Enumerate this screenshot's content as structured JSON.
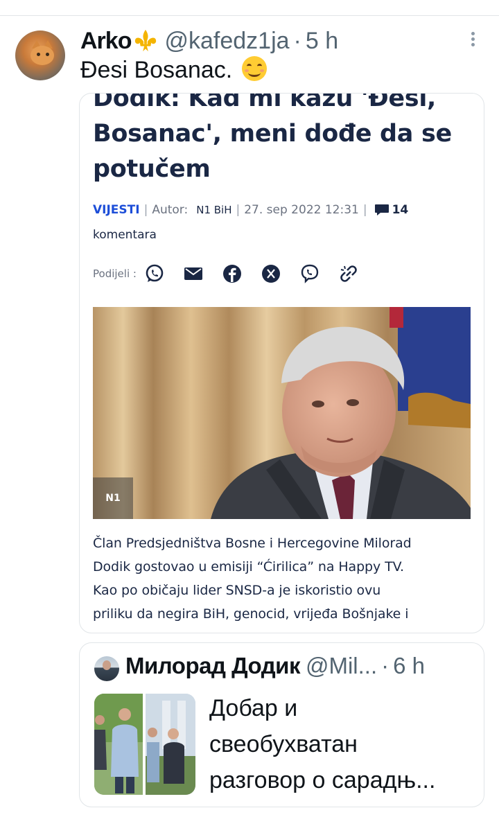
{
  "tweet": {
    "display_name": "Arko",
    "handle": "@kafedz1ja",
    "separator": "·",
    "time": "5 h",
    "text": "Đesi Bosanac.",
    "emoji": "smiling-face-icon"
  },
  "article": {
    "headline": "Dodik: Kad mi kažu 'Đesi, Bosanac', meni dođe da se potučem",
    "category": "VIJESTI",
    "author_label": "Autor:",
    "author": "N1 BiH",
    "date": "27. sep 2022 12:31",
    "comments_count": "14",
    "comments_label": "komentara",
    "share_label": "Podijeli :",
    "share_icons": [
      "whatsapp-icon",
      "mail-icon",
      "facebook-icon",
      "x-icon",
      "viber-icon",
      "link-icon"
    ],
    "photo_badge": "N1",
    "body_lines": [
      "Član Predsjedništva Bosne i Hercegovine Milorad",
      "Dodik gostovao u emisiji “Ćirilica” na Happy TV.",
      "Kao po običaju lider SNSD-a je iskoristio ovu",
      "priliku da negira BiH, genocid, vrijeđa Bošnjake i"
    ]
  },
  "quote": {
    "display_name": "Милорад Додик",
    "handle": "@Mil...",
    "separator": "·",
    "time": "6 h",
    "text_lines": [
      "Добар и",
      "свеобухватан",
      "разговор о сарадњ..."
    ]
  },
  "colors": {
    "headline": "#1a2744",
    "category": "#1d4ed8",
    "secondary_text": "#536471",
    "border": "#e1e5e8"
  }
}
